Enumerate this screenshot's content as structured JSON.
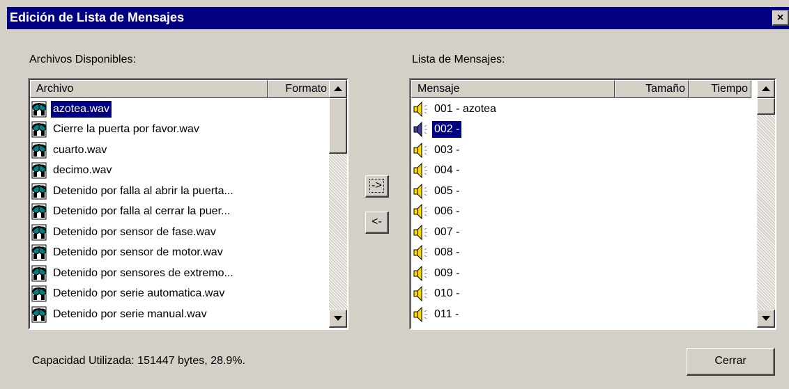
{
  "window": {
    "title": "Edición de Lista de Mensajes",
    "close_label": "×"
  },
  "left": {
    "label": "Archivos Disponibles:",
    "columns": [
      "Archivo",
      "Formato"
    ],
    "items": [
      {
        "name": "azotea.wav",
        "selected": true
      },
      {
        "name": "Cierre la puerta por favor.wav"
      },
      {
        "name": "cuarto.wav"
      },
      {
        "name": "decimo.wav"
      },
      {
        "name": "Detenido por falla al abrir la puerta..."
      },
      {
        "name": "Detenido por falla al cerrar la puer..."
      },
      {
        "name": "Detenido por sensor de fase.wav"
      },
      {
        "name": "Detenido por sensor de motor.wav"
      },
      {
        "name": "Detenido por sensores de extremo..."
      },
      {
        "name": "Detenido por serie automatica.wav"
      },
      {
        "name": "Detenido por serie manual.wav"
      }
    ],
    "icon": "audio-file-icon"
  },
  "buttons": {
    "add": "->",
    "remove": "<-",
    "close": "Cerrar"
  },
  "right": {
    "label": "Lista de Mensajes:",
    "columns": [
      "Mensaje",
      "Tamaño",
      "Tiempo"
    ],
    "items": [
      {
        "name": "001 - azotea"
      },
      {
        "name": "002 -",
        "selected": true
      },
      {
        "name": "003 -"
      },
      {
        "name": "004 -"
      },
      {
        "name": "005 -"
      },
      {
        "name": "006 -"
      },
      {
        "name": "007 -"
      },
      {
        "name": "008 -"
      },
      {
        "name": "009 -"
      },
      {
        "name": "010 -"
      },
      {
        "name": "011 -"
      }
    ],
    "icon": "speaker-icon"
  },
  "status": {
    "capacity": "Capacidad Utilizada: 151447 bytes, 28.9%."
  },
  "colors": {
    "titlebar": "#000080",
    "selection": "#000080",
    "face": "#d4d0c8"
  }
}
